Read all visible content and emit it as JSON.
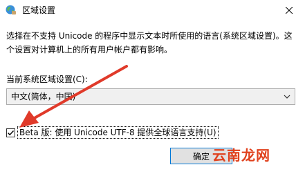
{
  "window": {
    "title": "区域设置",
    "icon": "globe-icon",
    "close_icon": "close-icon"
  },
  "description": "选择在不支持 Unicode 的程序中显示文本时所使用的语言(系统区域设置)。这个设置对计算机上的所有用户帐户都有影响。",
  "locale": {
    "label": "当前系统区域设置(C):",
    "selected": "中文(简体，中国)",
    "chevron_icon": "chevron-down-icon"
  },
  "beta_option": {
    "label": "Beta 版: 使用 Unicode UTF-8 提供全球语言支持(U)",
    "checked": true
  },
  "buttons": {
    "ok_label": "确定"
  },
  "watermark": "云南龙网",
  "annotation": {
    "arrow_color": "#e03a2a"
  }
}
